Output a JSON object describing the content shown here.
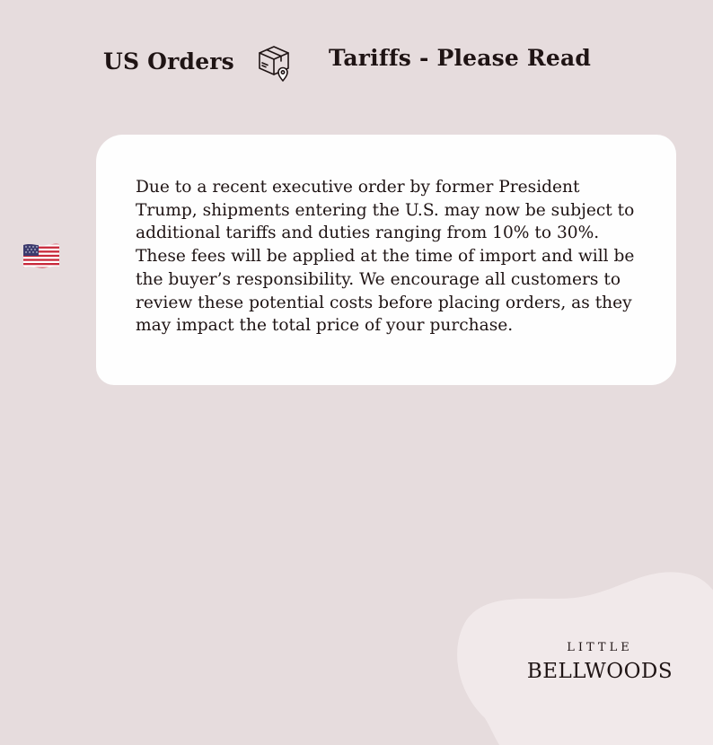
{
  "header": {
    "left_title": "US Orders",
    "right_title": "Tariffs - Please Read",
    "center_icon": "package-location-icon"
  },
  "notice": {
    "flag_icon": "us-flag-icon",
    "lines": [
      "Due to a recent executive order by former President",
      "Trump, shipments entering the U.S. may now be subject to",
      "additional tariffs and duties ranging from 10% to 30%.",
      "These fees will be applied at the time of import and will be",
      "the buyer’s responsibility. We encourage all customers to",
      "review these potential costs before placing orders, as they",
      "may impact the total price of your purchase."
    ]
  },
  "brand": {
    "small": "LITTLE",
    "large": "BELLWOODS"
  },
  "colors": {
    "background": "#e6dcdd",
    "card": "#fefefe",
    "text": "#1f1414",
    "blob": "#f1e9ea"
  }
}
